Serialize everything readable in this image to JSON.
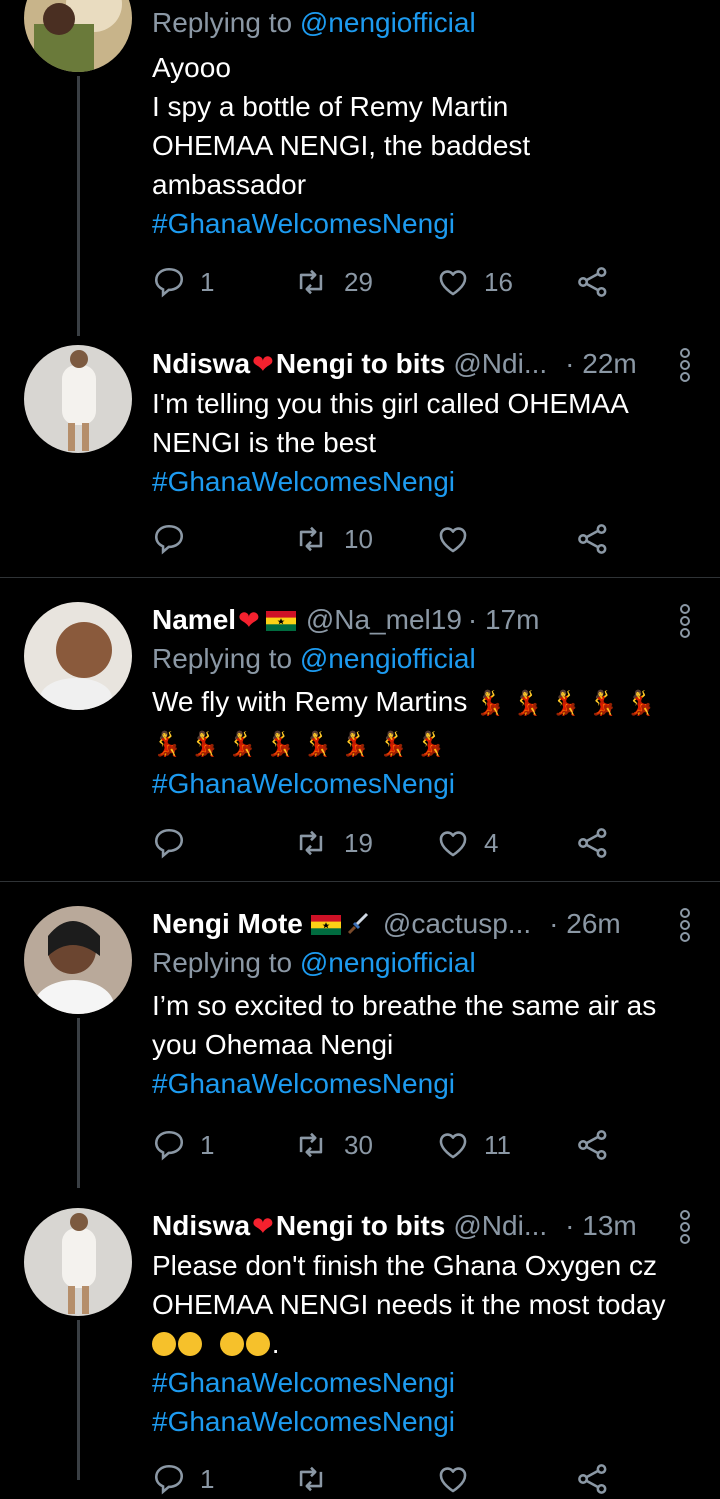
{
  "tweets": [
    {
      "reply_prefix": "Replying to ",
      "reply_to": "@nengiofficial",
      "lines": [
        "Ayooo",
        "I spy a bottle of Remy Martin",
        "OHEMAA NENGI, the baddest",
        "ambassador"
      ],
      "hashtag": "#GhanaWelcomesNengi",
      "replies": "1",
      "retweets": "29",
      "likes": "16"
    },
    {
      "name_part1": "Ndiswa",
      "name_part2": "Nengi to bits",
      "handle": "@Ndi...",
      "time": "· 22m",
      "lines": [
        "I'm telling you this girl  called OHEMAA",
        "NENGI is the best"
      ],
      "hashtag": "#GhanaWelcomesNengi",
      "replies": "",
      "retweets": "10",
      "likes": ""
    },
    {
      "name_part1": "Namel",
      "handle": "@Na_mel19",
      "time": "· 17m",
      "reply_prefix": "Replying to ",
      "reply_to": "@nengiofficial",
      "line1": "We fly with Remy Martins",
      "dancer_emoji": "💃",
      "hashtag": "#GhanaWelcomesNengi",
      "replies": "",
      "retweets": "19",
      "likes": "4"
    },
    {
      "name_part1": "Nengi Mote",
      "handle": "@cactusp...",
      "time": "· 26m",
      "reply_prefix": "Replying to ",
      "reply_to": "@nengiofficial",
      "lines": [
        "I’m so excited to breathe the same air as",
        "you Ohemaa Nengi"
      ],
      "hashtag": "#GhanaWelcomesNengi",
      "replies": "1",
      "retweets": "30",
      "likes": "11"
    },
    {
      "name_part1": "Ndiswa",
      "name_part2": "Nengi to bits",
      "handle": "@Ndi...",
      "time": "· 13m",
      "lines": [
        "Please don't finish the Ghana Oxygen cz",
        "OHEMAA NENGI needs it the most today"
      ],
      "after_emoji": ".",
      "hashtag": "#GhanaWelcomesNengi",
      "replies": "1",
      "retweets": "",
      "likes": ""
    }
  ],
  "icons": {
    "reply": "reply-icon",
    "retweet": "retweet-icon",
    "like": "heart-icon",
    "share": "share-icon",
    "more": "more-vertical-icon"
  },
  "colors": {
    "background": "#000000",
    "link": "#1d9bf0",
    "secondary": "#8b98a5",
    "divider": "#2f3336"
  }
}
